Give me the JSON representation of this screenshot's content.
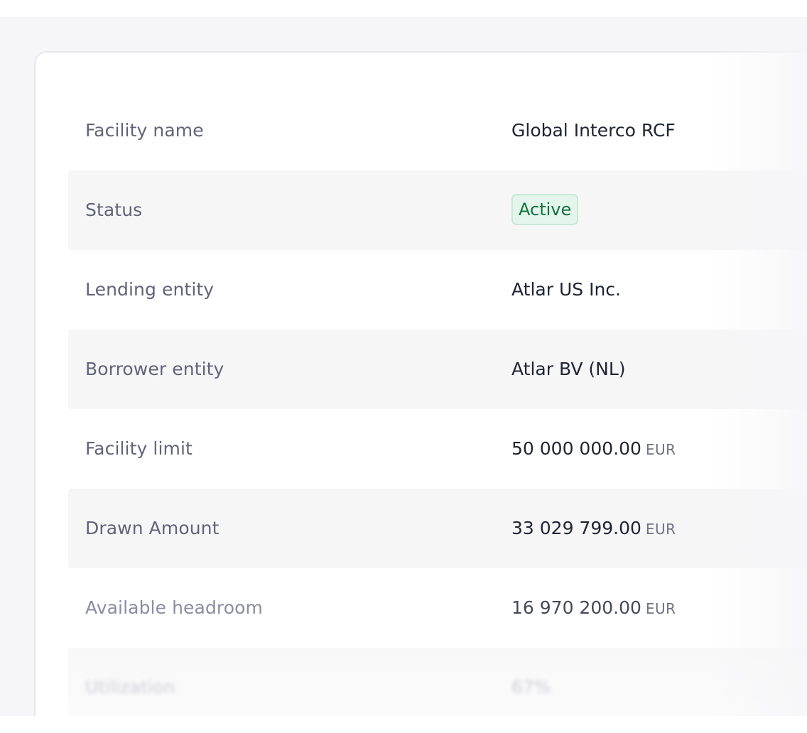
{
  "facility": {
    "rows": [
      {
        "label": "Facility name",
        "value": "Global Interco RCF"
      },
      {
        "label": "Status",
        "value": "Active",
        "status_color": "#13703f"
      },
      {
        "label": "Lending entity",
        "value": "Atlar US Inc."
      },
      {
        "label": "Borrower entity",
        "value": "Atlar BV (NL)"
      },
      {
        "label": "Facility limit",
        "value": "50 000 000.00",
        "currency": "EUR"
      },
      {
        "label": "Drawn Amount",
        "value": "33 029 799.00",
        "currency": "EUR"
      },
      {
        "label": "Available headroom",
        "value": "16 970 200.00",
        "currency": "EUR"
      },
      {
        "label": "Utilization",
        "value": "67%"
      }
    ]
  }
}
